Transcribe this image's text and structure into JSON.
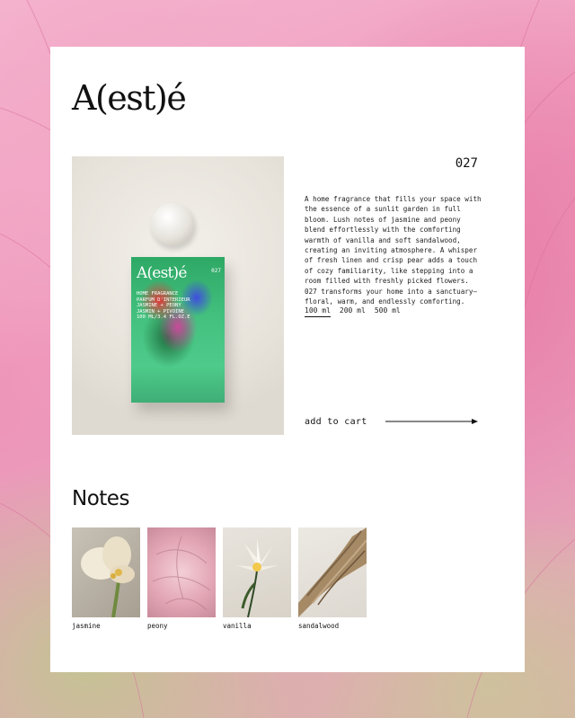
{
  "brand": {
    "logo": "A(est)é"
  },
  "product": {
    "number": "027",
    "image_label": "bottle product photo",
    "bottle": {
      "logo": "A(est)é",
      "number": "027",
      "lines": [
        "HOME FRAGRANCE",
        "PARFUM D'INTERIEUR",
        "JASMINE + PEONY",
        "JASMIN + PIVOINE",
        "100 ML/3.4 FL.OZ.E"
      ]
    },
    "description": "A home fragrance that fills your space with the essence of a sunlit garden in full bloom. Lush notes of jasmine and peony blend effortlessly with the comforting warmth of vanilla and soft sandalwood, creating an inviting atmosphere. A whisper of fresh linen and crisp pear adds a touch of cozy familiarity, like stepping into a room filled with freshly picked flowers. 027 transforms your home into a sanctuary—floral, warm, and endlessly comforting.",
    "sizes": [
      "100 ml",
      "200 ml",
      "500 ml"
    ],
    "selected_size": "100 ml",
    "add_to_cart": "add to cart"
  },
  "notes": {
    "title": "Notes",
    "items": [
      {
        "label": "jasmine",
        "icon": "jasmine-photo"
      },
      {
        "label": "peony",
        "icon": "peony-photo"
      },
      {
        "label": "vanilla",
        "icon": "vanilla-photo"
      },
      {
        "label": "sandalwood",
        "icon": "sandalwood-photo"
      }
    ]
  },
  "colors": {
    "background": "#ee93b8",
    "card": "#ffffff",
    "text": "#111111",
    "bottle": "#43c07e"
  }
}
